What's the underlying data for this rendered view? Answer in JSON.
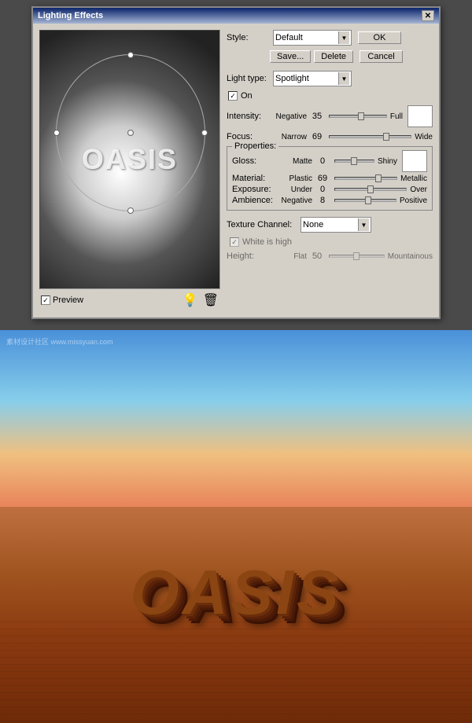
{
  "dialog": {
    "title": "Lighting Effects",
    "close_btn": "✕",
    "style_label": "Style:",
    "style_value": "Default",
    "save_label": "Save...",
    "delete_label": "Delete",
    "ok_label": "OK",
    "cancel_label": "Cancel",
    "light_type_label": "Light type:",
    "light_type_value": "Spotlight",
    "on_label": "On",
    "intensity_label": "Intensity:",
    "intensity_left": "Negative",
    "intensity_right": "Full",
    "intensity_value": "35",
    "intensity_pct": 55,
    "focus_label": "Focus:",
    "focus_left": "Narrow",
    "focus_right": "Wide",
    "focus_value": "69",
    "focus_pct": 70,
    "properties_label": "Properties:",
    "gloss_label": "Gloss:",
    "gloss_left": "Matte",
    "gloss_right": "Shiny",
    "gloss_value": "0",
    "gloss_pct": 50,
    "material_label": "Material:",
    "material_left": "Plastic",
    "material_right": "Metallic",
    "material_value": "69",
    "material_pct": 70,
    "exposure_label": "Exposure:",
    "exposure_left": "Under",
    "exposure_right": "Over",
    "exposure_value": "0",
    "exposure_pct": 50,
    "ambience_label": "Ambience:",
    "ambience_left": "Negative",
    "ambience_right": "Positive",
    "ambience_value": "8",
    "ambience_pct": 54,
    "texture_channel_label": "Texture Channel:",
    "texture_channel_value": "None",
    "white_is_high_label": "White is high",
    "height_label": "Height:",
    "height_left": "Flat",
    "height_right": "Mountainous",
    "height_value": "50",
    "height_pct": 50,
    "preview_label": "Preview"
  },
  "preview": {
    "oasis_text": "OASIS"
  },
  "desert": {
    "oasis_text": "OASIS"
  },
  "watermark": "素材设计社区 www.missyuan.com"
}
